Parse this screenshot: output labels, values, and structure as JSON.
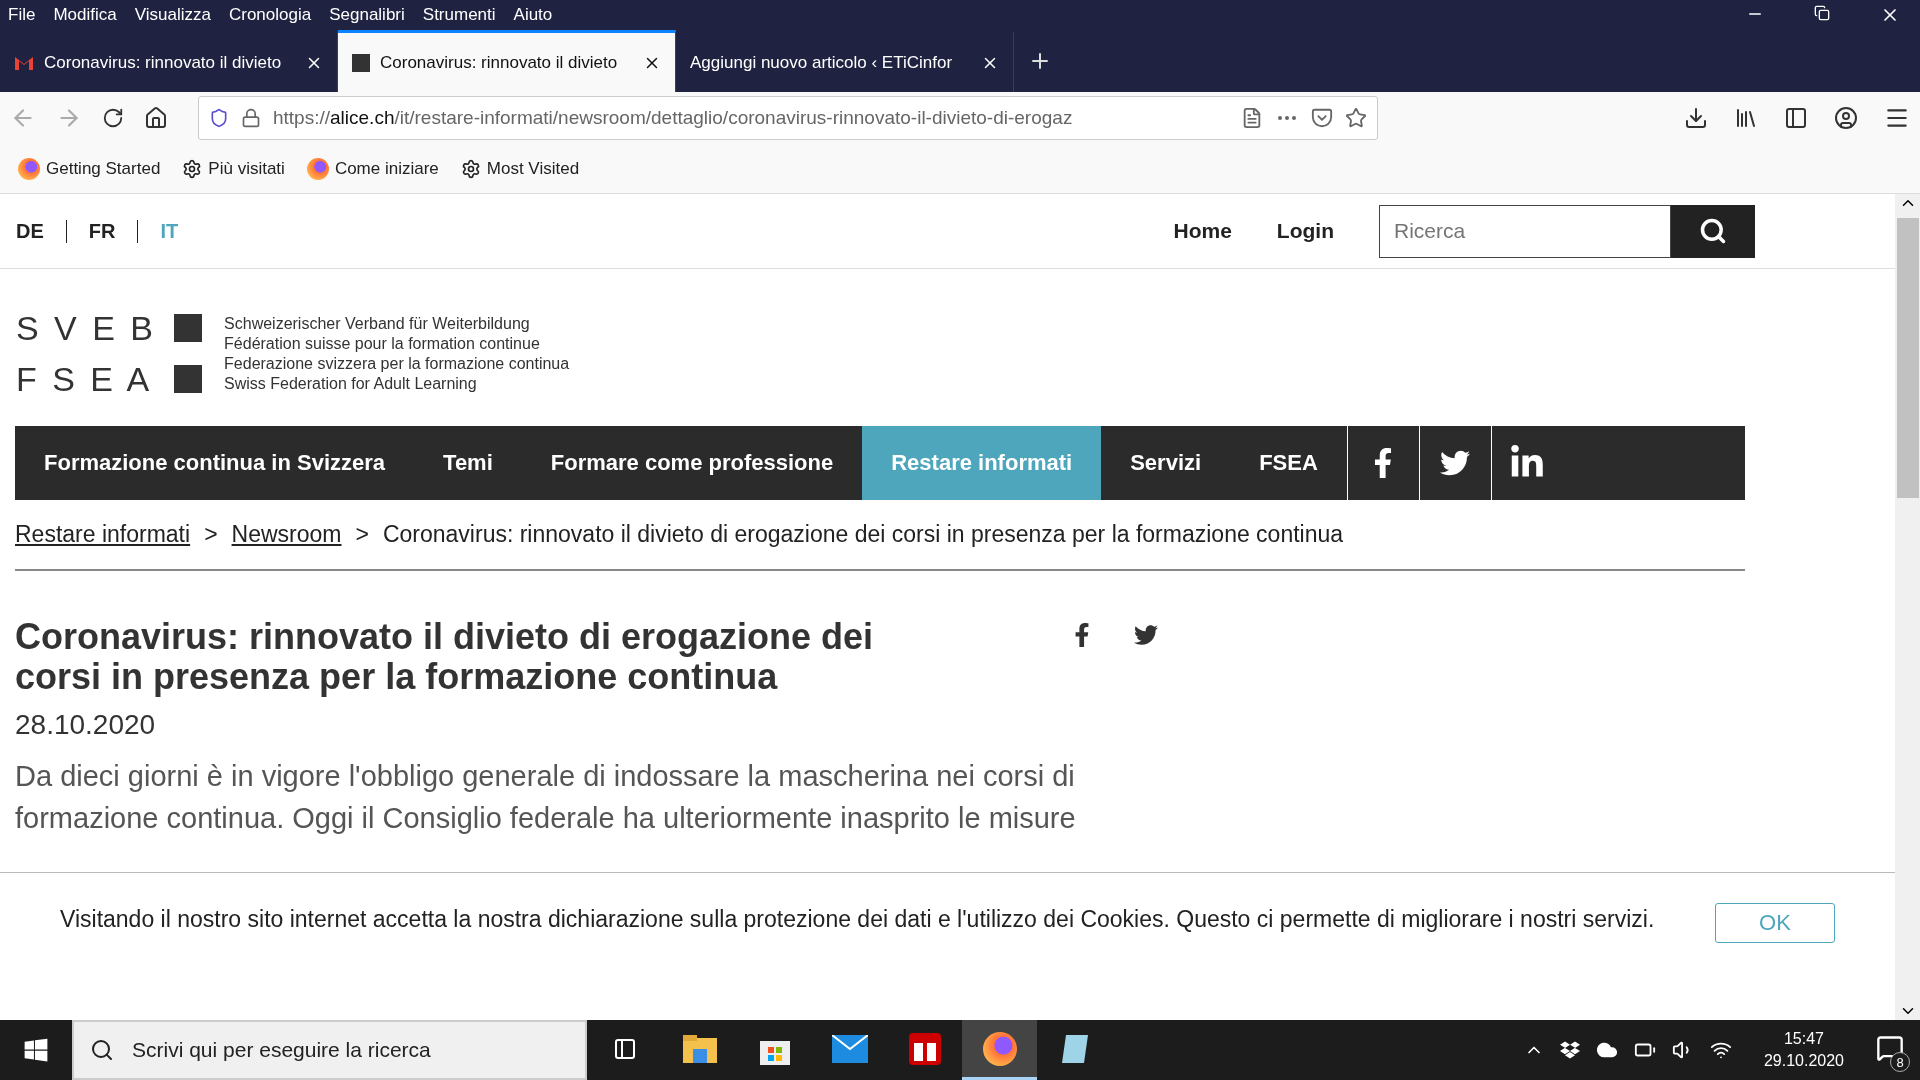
{
  "menu": [
    "File",
    "Modifica",
    "Visualizza",
    "Cronologia",
    "Segnalibri",
    "Strumenti",
    "Aiuto"
  ],
  "tabs": [
    {
      "kind": "mail",
      "title": "Coronavirus: rinnovato il divieto",
      "selected": false
    },
    {
      "kind": "site",
      "title": "Coronavirus: rinnovato il divieto",
      "selected": true
    },
    {
      "kind": "none",
      "title": "Aggiungi nuovo articolo ‹ ETiCinfor",
      "selected": false
    }
  ],
  "url": {
    "prefix": "https://",
    "domain": "alice.ch",
    "path": "/it/restare-informati/newsroom/dettaglio/coronavirus-rinnovato-il-divieto-di-erogaz"
  },
  "bookmarks": [
    {
      "kind": "firefox",
      "label": "Getting Started"
    },
    {
      "kind": "gear",
      "label": "Più visitati"
    },
    {
      "kind": "firefox",
      "label": "Come iniziare"
    },
    {
      "kind": "gear",
      "label": "Most Visited"
    }
  ],
  "languages": [
    {
      "label": "DE",
      "selected": false
    },
    {
      "label": "FR",
      "selected": false
    },
    {
      "label": "IT",
      "selected": true
    }
  ],
  "top_links": [
    "Home",
    "Login"
  ],
  "search": {
    "placeholder": "Ricerca"
  },
  "logo": {
    "line_1": "S V E B",
    "line_2": "F S E A",
    "taglines": [
      "Schweizerischer Verband für Weiterbildung",
      "Fédération suisse pour la formation continue",
      "Federazione svizzera per la formazione continua",
      "Swiss Federation for Adult Learning"
    ]
  },
  "nav": [
    {
      "label": "Formazione continua in Svizzera",
      "selected": false
    },
    {
      "label": "Temi",
      "selected": false
    },
    {
      "label": "Formare come professione",
      "selected": false
    },
    {
      "label": "Restare informati",
      "selected": true
    },
    {
      "label": "Servizi",
      "selected": false
    },
    {
      "label": "FSEA",
      "selected": false
    }
  ],
  "breadcrumb": {
    "links": [
      "Restare informati",
      "Newsroom"
    ],
    "separator": ">",
    "current": "Coronavirus: rinnovato il divieto di erogazione dei corsi in presenza per la formazione continua"
  },
  "article": {
    "title": "Coronavirus: rinnovato il divieto di erogazione dei corsi in presenza per la formazione continua",
    "date": "28.10.2020",
    "lead": "Da dieci giorni è in vigore l'obbligo generale di indossare la mascherina nei corsi di formazione continua. Oggi il Consiglio federale ha ulteriormente inasprito le misure"
  },
  "cookie": {
    "text": "Visitando il nostro sito internet accetta la nostra dichiarazione sulla protezione dei dati e l'utilizzo dei Cookies. Questo ci permette di migliorare i nostri servizi.",
    "button": "OK"
  },
  "taskbar": {
    "search_placeholder": "Scrivi qui per eseguire la ricerca",
    "apps": [
      {
        "kind": "taskview",
        "selected": false
      },
      {
        "kind": "files",
        "selected": false
      },
      {
        "kind": "store",
        "selected": false
      },
      {
        "kind": "mail",
        "selected": false
      },
      {
        "kind": "gift",
        "selected": false
      },
      {
        "kind": "firefox",
        "selected": true
      },
      {
        "kind": "notepad",
        "selected": false
      }
    ],
    "time": "15:47",
    "date": "29.10.2020",
    "notifications": "8"
  }
}
